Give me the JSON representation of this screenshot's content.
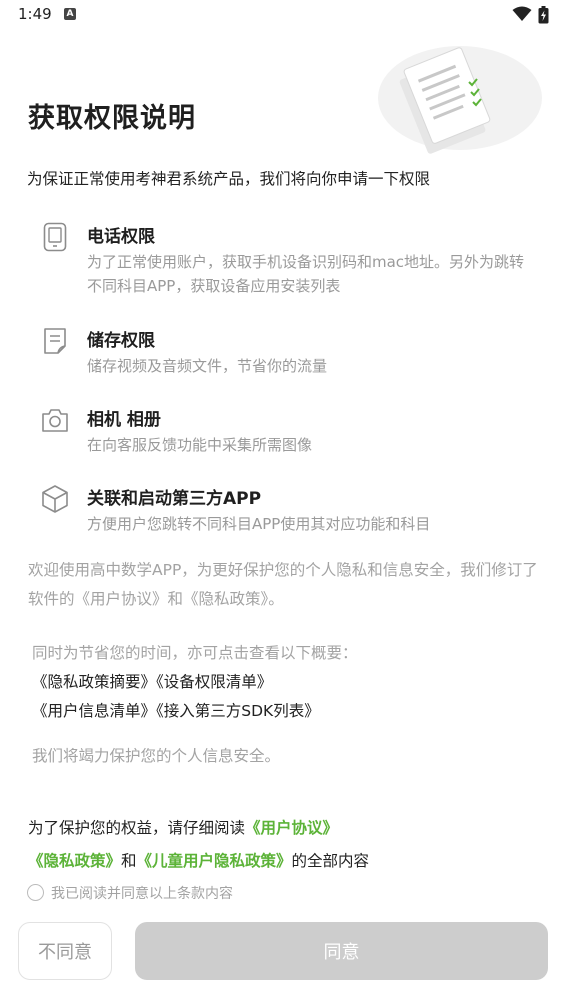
{
  "status_bar": {
    "time": "1:49",
    "notif_letter": "A"
  },
  "title": "获取权限说明",
  "intro": "为保证正常使用考神君系统产品，我们将向你申请一下权限",
  "permissions": [
    {
      "icon": "phone-icon",
      "title": "电话权限",
      "desc": "为了正常使用账户，获取手机设备识别码和mac地址。另外为跳转不同科目APP，获取设备应用安装列表"
    },
    {
      "icon": "storage-icon",
      "title": "储存权限",
      "desc": "储存视频及音频文件，节省你的流量"
    },
    {
      "icon": "camera-icon",
      "title": "相机 相册",
      "desc": "在向客服反馈功能中采集所需图像"
    },
    {
      "icon": "cube-icon",
      "title": "关联和启动第三方APP",
      "desc": "方便用户您跳转不同科目APP使用其对应功能和科目"
    }
  ],
  "notice": "欢迎使用高中数学APP，为更好保护您的个人隐私和信息安全，我们修订了软件的《用户协议》和《隐私政策》。",
  "summary": {
    "hint": "同时为节省您的时间，亦可点击查看以下概要：",
    "link_privacy_summary": "《隐私政策摘要》",
    "link_device_permissions": "《设备权限清单》",
    "link_user_info": "《用户信息清单》",
    "link_sdk": "《接入第三方SDK列表》"
  },
  "care": "我们将竭力保护您的个人信息安全。",
  "agreement": {
    "prefix": "为了保护您的权益，请仔细阅读",
    "user_agreement": "《用户协议》",
    "privacy_policy": "《隐私政策》",
    "and": "和",
    "child_privacy": "《儿童用户隐私政策》",
    "suffix": "的全部内容"
  },
  "consent_label": "我已阅读并同意以上条款内容",
  "buttons": {
    "disagree": "不同意",
    "agree": "同意"
  },
  "colors": {
    "accent_green": "#5cb338",
    "agree_button_disabled": "#cdcdcd"
  }
}
